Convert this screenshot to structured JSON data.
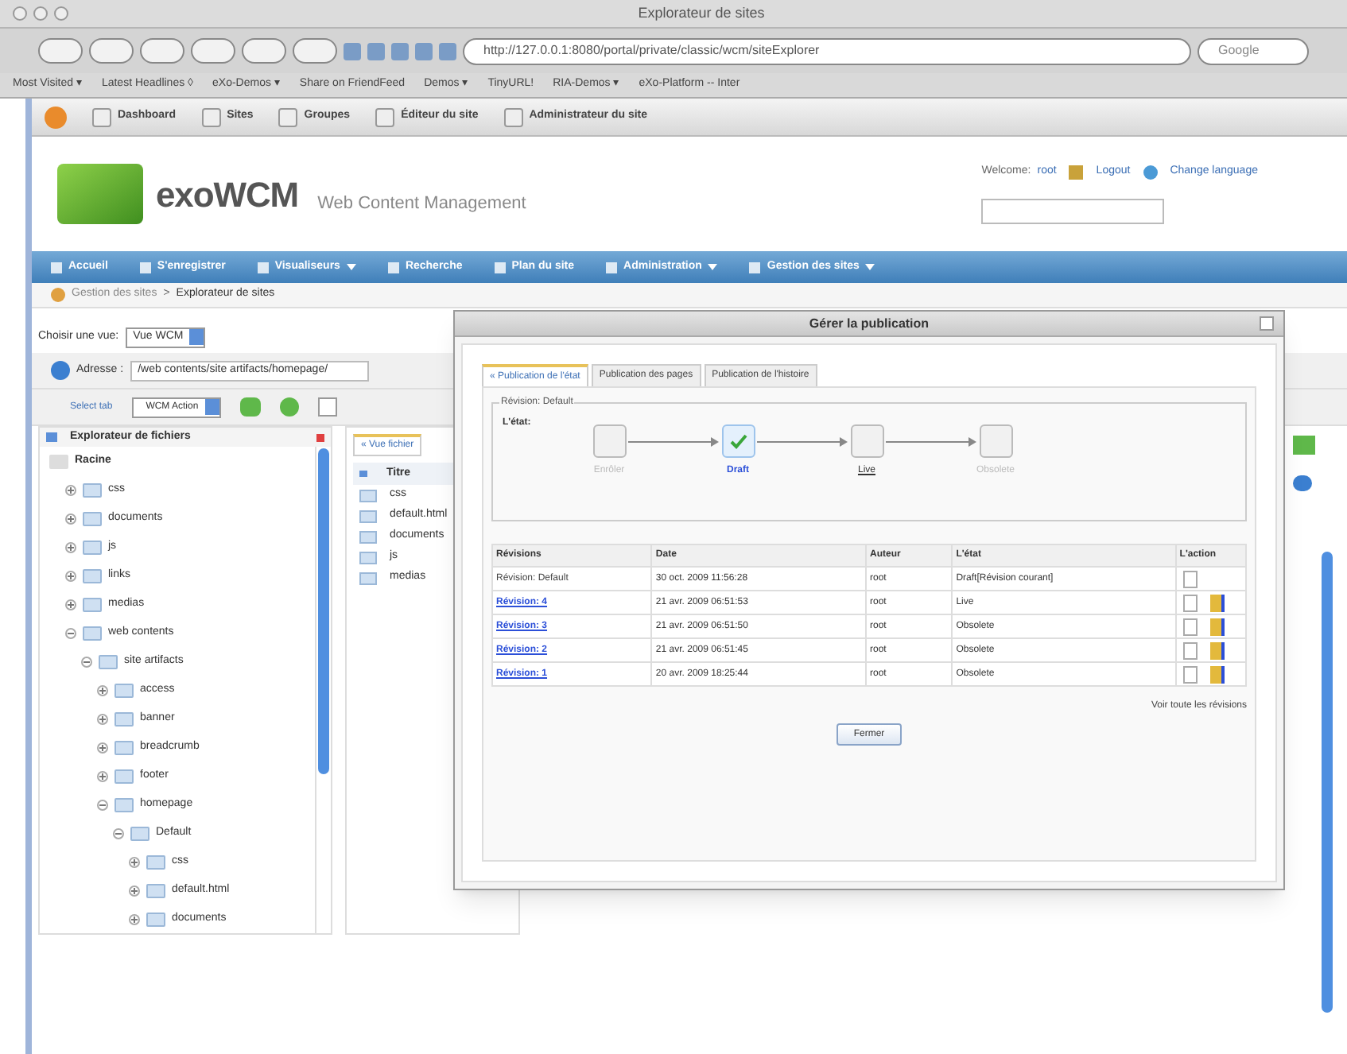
{
  "window": {
    "title": "Explorateur de sites"
  },
  "browser": {
    "url": "http://127.0.0.1:8080/portal/private/classic/wcm/siteExplorer",
    "search_placeholder": "Google",
    "bookmarks": [
      "Most Visited ▾",
      "Latest Headlines ◊",
      "eXo-Demos ▾",
      "Share on FriendFeed",
      "Demos ▾",
      "TinyURL!",
      "RIA-Demos ▾",
      "eXo-Platform -- Inter"
    ]
  },
  "portal_toolbar": [
    "Dashboard",
    "Sites",
    "Groupes",
    "Éditeur du site",
    "Administrateur du site"
  ],
  "header": {
    "logo": "exoWCM",
    "subtitle": "Web Content Management",
    "welcome": "Welcome:",
    "user": "root",
    "logout": "Logout",
    "change_language": "Change language"
  },
  "nav": [
    {
      "label": "Accueil",
      "dropdown": false
    },
    {
      "label": "S'enregistrer",
      "dropdown": false
    },
    {
      "label": "Visualiseurs",
      "dropdown": true
    },
    {
      "label": "Recherche",
      "dropdown": false
    },
    {
      "label": "Plan du site",
      "dropdown": false
    },
    {
      "label": "Administration",
      "dropdown": true
    },
    {
      "label": "Gestion des sites",
      "dropdown": true
    }
  ],
  "breadcrumb": [
    "Gestion des sites",
    "Explorateur de sites"
  ],
  "breadcrumb_separator": ">",
  "explorer": {
    "view_label": "Choisir une vue:",
    "view_value": "Vue WCM",
    "address_label": "Adresse :",
    "address_value": "/web contents/site artifacts/homepage/",
    "select_tab": "Select tab",
    "action_value": "WCM Action",
    "tree_title": "Explorateur de fichiers",
    "tree": [
      {
        "label": "Racine",
        "children": [
          {
            "label": "css",
            "expanded": false
          },
          {
            "label": "documents",
            "expanded": false
          },
          {
            "label": "js",
            "expanded": false
          },
          {
            "label": "links",
            "expanded": false
          },
          {
            "label": "medias",
            "expanded": false
          },
          {
            "label": "web contents",
            "expanded": true,
            "children": [
              {
                "label": "site artifacts",
                "expanded": true,
                "children": [
                  {
                    "label": "access",
                    "expanded": false
                  },
                  {
                    "label": "banner",
                    "expanded": false
                  },
                  {
                    "label": "breadcrumb",
                    "expanded": false
                  },
                  {
                    "label": "footer",
                    "expanded": false
                  },
                  {
                    "label": "homepage",
                    "expanded": true,
                    "children": [
                      {
                        "label": "Default",
                        "expanded": true,
                        "children": [
                          {
                            "label": "css",
                            "expanded": false
                          },
                          {
                            "label": "default.html",
                            "expanded": false
                          },
                          {
                            "label": "documents",
                            "expanded": false
                          }
                        ]
                      }
                    ]
                  }
                ]
              }
            ]
          }
        ]
      }
    ],
    "file_tab": "« Vue fichier",
    "list_header": "Titre",
    "files": [
      "css",
      "default.html",
      "documents",
      "js",
      "medias"
    ]
  },
  "dialog": {
    "title": "Gérer la publication",
    "tabs": [
      {
        "label": "« Publication de l'état",
        "selected": true
      },
      {
        "label": "Publication des pages",
        "selected": false
      },
      {
        "label": "Publication de l'histoire",
        "selected": false
      }
    ],
    "revision_legend": "Révision: Default",
    "state_label": "L'état:",
    "steps": [
      {
        "label": "Enrôler",
        "kind": "inactive"
      },
      {
        "label": "Draft",
        "kind": "current"
      },
      {
        "label": "Live",
        "kind": "link"
      },
      {
        "label": "Obsolete",
        "kind": "inactive"
      }
    ],
    "columns": [
      "Révisions",
      "Date",
      "Auteur",
      "L'état",
      "L'action"
    ],
    "rows": [
      {
        "revision": "Révision: Default",
        "link": false,
        "date": "30 oct. 2009 11:56:28",
        "author": "root",
        "state": "Draft[Révision courant]",
        "restore": false
      },
      {
        "revision": "Révision: 4",
        "link": true,
        "date": "21 avr. 2009 06:51:53",
        "author": "root",
        "state": "Live",
        "restore": true
      },
      {
        "revision": "Révision: 3",
        "link": true,
        "date": "21 avr. 2009 06:51:50",
        "author": "root",
        "state": "Obsolete",
        "restore": true
      },
      {
        "revision": "Révision: 2",
        "link": true,
        "date": "21 avr. 2009 06:51:45",
        "author": "root",
        "state": "Obsolete",
        "restore": true
      },
      {
        "revision": "Révision: 1",
        "link": true,
        "date": "20 avr. 2009 18:25:44",
        "author": "root",
        "state": "Obsolete",
        "restore": true
      }
    ],
    "see_all": "Voir toute les révisions",
    "close_button": "Fermer"
  }
}
